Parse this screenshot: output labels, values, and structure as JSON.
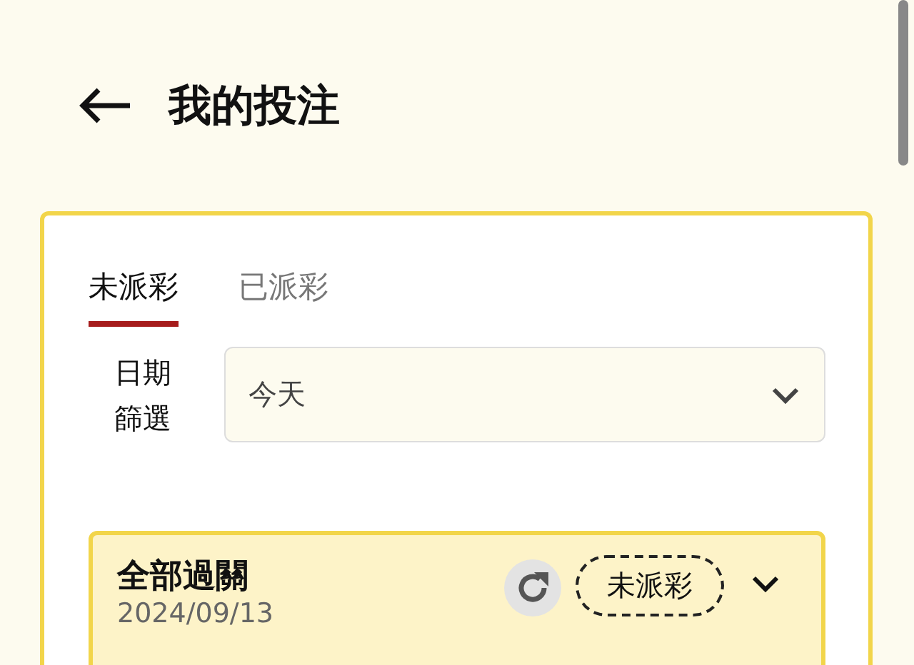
{
  "header": {
    "title": "我的投注"
  },
  "tabs": [
    {
      "label": "未派彩",
      "selected": true
    },
    {
      "label": "已派彩",
      "selected": false
    }
  ],
  "date_filter": {
    "label": "日期篩選",
    "value": "今天"
  },
  "bets": [
    {
      "title": "全部過關",
      "date": "2024/09/13",
      "status": "未派彩",
      "expanded": false
    }
  ]
}
